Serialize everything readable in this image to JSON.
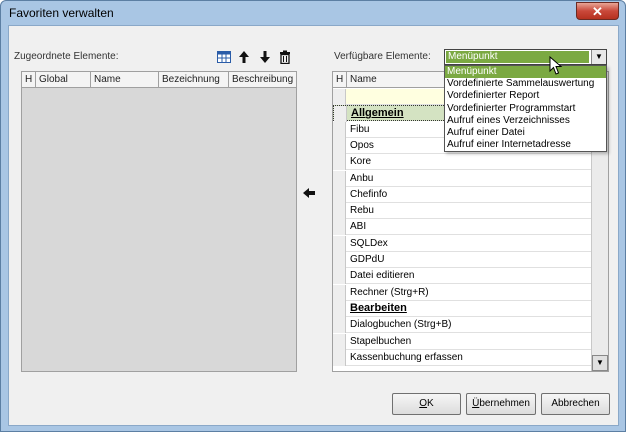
{
  "window": {
    "title": "Favoriten verwalten",
    "close_glyph": "✕"
  },
  "left_panel": {
    "label": "Zugeordnete Elemente:",
    "columns": [
      "H",
      "Global",
      "Name",
      "Bezeichnung",
      "Beschreibung"
    ],
    "toolbar_icons": [
      "grid-icon",
      "arrow-up-icon",
      "arrow-down-icon",
      "trash-icon"
    ]
  },
  "move_left_glyph": "🡐",
  "right_panel": {
    "label": "Verfügbare Elemente:",
    "combo_value": "Menüpunkt",
    "columns": [
      "H",
      "Name"
    ],
    "rows": [
      {
        "text": "",
        "type": "filter"
      },
      {
        "text": "Allgemein",
        "type": "group-active"
      },
      {
        "text": "Fibu",
        "type": "item"
      },
      {
        "text": "Opos",
        "type": "item"
      },
      {
        "text": "Kore",
        "type": "item"
      },
      {
        "text": "Anbu",
        "type": "item"
      },
      {
        "text": "Chefinfo",
        "type": "item"
      },
      {
        "text": "Rebu",
        "type": "item"
      },
      {
        "text": "ABI",
        "type": "item"
      },
      {
        "text": "SQLDex",
        "type": "item"
      },
      {
        "text": "GDPdU",
        "type": "item"
      },
      {
        "text": "Datei editieren",
        "type": "item"
      },
      {
        "text": "Rechner (Strg+R)",
        "type": "item"
      },
      {
        "text": "Bearbeiten",
        "type": "group"
      },
      {
        "text": "Dialogbuchen (Strg+B)",
        "type": "item"
      },
      {
        "text": "Stapelbuchen",
        "type": "item"
      },
      {
        "text": "Kassenbuchung erfassen",
        "type": "item"
      }
    ]
  },
  "dropdown": {
    "options": [
      "Menüpunkt",
      "Vordefinierte Sammelauswertung",
      "Vordefinierter Report",
      "Vordefinierter Programmstart",
      "Aufruf eines Verzeichnisses",
      "Aufruf einer Datei",
      "Aufruf einer Internetadresse"
    ],
    "selected_index": 0
  },
  "buttons": {
    "ok": {
      "label_underlined": "O",
      "label_rest": "K"
    },
    "apply": {
      "label_underlined": "Ü",
      "label_rest": "bernehmen"
    },
    "cancel": {
      "label_underlined": "",
      "label_rest": "Abbrechen"
    }
  },
  "colors": {
    "selection": "#7ba942",
    "window_frame": "#a9c6e4"
  }
}
